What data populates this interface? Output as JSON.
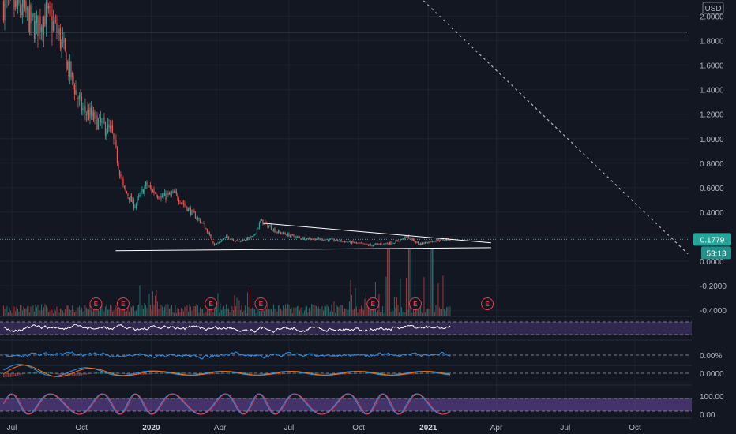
{
  "chart_data": {
    "type": "candlestick",
    "currency": "USD",
    "price_axis": {
      "ticks": [
        "2.0000",
        "1.8000",
        "1.6000",
        "1.4000",
        "1.2000",
        "1.0000",
        "0.8000",
        "0.6000",
        "0.4000",
        "0.2000",
        "0.0000",
        "-0.2000",
        "-0.4000"
      ],
      "tick_values": [
        2.0,
        1.8,
        1.6,
        1.4,
        1.2,
        1.0,
        0.8,
        0.6,
        0.4,
        0.2,
        0.0,
        -0.2,
        -0.4
      ],
      "range": [
        -0.44,
        2.13
      ]
    },
    "time_axis": {
      "labels": [
        "Jul",
        "Oct",
        "2020",
        "Apr",
        "Jul",
        "Oct",
        "2021",
        "Apr",
        "Jul",
        "Oct"
      ],
      "bold": [
        false,
        false,
        true,
        false,
        false,
        false,
        true,
        false,
        false,
        false
      ]
    },
    "last_price": {
      "label": "0.1779",
      "value": 0.1779,
      "color": "#26a69a"
    },
    "countdown": {
      "label": "53:13"
    },
    "horizontal_line": {
      "value": 1.87
    },
    "triangle": {
      "upper": [
        {
          "date": "2020-05-28",
          "value": 0.31
        },
        {
          "date": "2021-03-25",
          "value": 0.15
        }
      ],
      "lower": [
        {
          "date": "2019-11-15",
          "value": 0.085
        },
        {
          "date": "2021-03-25",
          "value": 0.11
        }
      ]
    },
    "dotted_trend": [
      {
        "date": "2020-12-10",
        "value": 2.22
      },
      {
        "date": "2021-12-10",
        "value": 0.06
      }
    ],
    "price_path": [
      {
        "date": "2019-06-20",
        "value": 2.1
      },
      {
        "date": "2019-07-15",
        "value": 2.05
      },
      {
        "date": "2019-08-01",
        "value": 1.9
      },
      {
        "date": "2019-08-15",
        "value": 2.02
      },
      {
        "date": "2019-09-01",
        "value": 1.85
      },
      {
        "date": "2019-09-15",
        "value": 1.55
      },
      {
        "date": "2019-10-01",
        "value": 1.25
      },
      {
        "date": "2019-10-20",
        "value": 1.15
      },
      {
        "date": "2019-11-10",
        "value": 1.05
      },
      {
        "date": "2019-11-25",
        "value": 0.6
      },
      {
        "date": "2019-12-10",
        "value": 0.45
      },
      {
        "date": "2019-12-25",
        "value": 0.62
      },
      {
        "date": "2020-01-15",
        "value": 0.52
      },
      {
        "date": "2020-02-01",
        "value": 0.55
      },
      {
        "date": "2020-02-20",
        "value": 0.42
      },
      {
        "date": "2020-03-10",
        "value": 0.3
      },
      {
        "date": "2020-03-25",
        "value": 0.13
      },
      {
        "date": "2020-04-10",
        "value": 0.2
      },
      {
        "date": "2020-04-25",
        "value": 0.16
      },
      {
        "date": "2020-05-15",
        "value": 0.2
      },
      {
        "date": "2020-05-25",
        "value": 0.33
      },
      {
        "date": "2020-06-15",
        "value": 0.24
      },
      {
        "date": "2020-07-15",
        "value": 0.19
      },
      {
        "date": "2020-08-15",
        "value": 0.18
      },
      {
        "date": "2020-09-15",
        "value": 0.16
      },
      {
        "date": "2020-10-15",
        "value": 0.13
      },
      {
        "date": "2020-11-15",
        "value": 0.15
      },
      {
        "date": "2020-12-05",
        "value": 0.2
      },
      {
        "date": "2020-12-20",
        "value": 0.14
      },
      {
        "date": "2021-01-10",
        "value": 0.17
      },
      {
        "date": "2021-01-30",
        "value": 0.18
      }
    ],
    "earnings_markers": {
      "label": "E",
      "dates": [
        "2019-10-20",
        "2019-11-25",
        "2020-03-20",
        "2020-05-25",
        "2020-10-20",
        "2020-12-15",
        "2021-03-20"
      ]
    },
    "indicator_panes": [
      {
        "name": "oscillator",
        "type": "line",
        "color": "#ffffff",
        "band": true,
        "band_color": "#7e57c2"
      },
      {
        "name": "percent",
        "type": "line",
        "color": "#2196f3",
        "axis_labels": [
          "0.00%"
        ],
        "axis_values": [
          0.0
        ]
      },
      {
        "name": "macd",
        "type": "macd",
        "colors": [
          "#2196f3",
          "#ff6d00"
        ],
        "axis_labels": [
          "0.0000"
        ],
        "axis_values": [
          0.0
        ]
      },
      {
        "name": "stochastic",
        "type": "line",
        "colors": [
          "#2196f3",
          "#f23645"
        ],
        "axis_labels": [
          "100.00",
          "0.00"
        ],
        "axis_values": [
          100,
          0
        ],
        "band": true,
        "band_color": "#7e57c2"
      }
    ],
    "colors": {
      "up": "#26a69a",
      "down": "#ef5350",
      "grid": "#1e222d",
      "background": "#131722"
    }
  }
}
